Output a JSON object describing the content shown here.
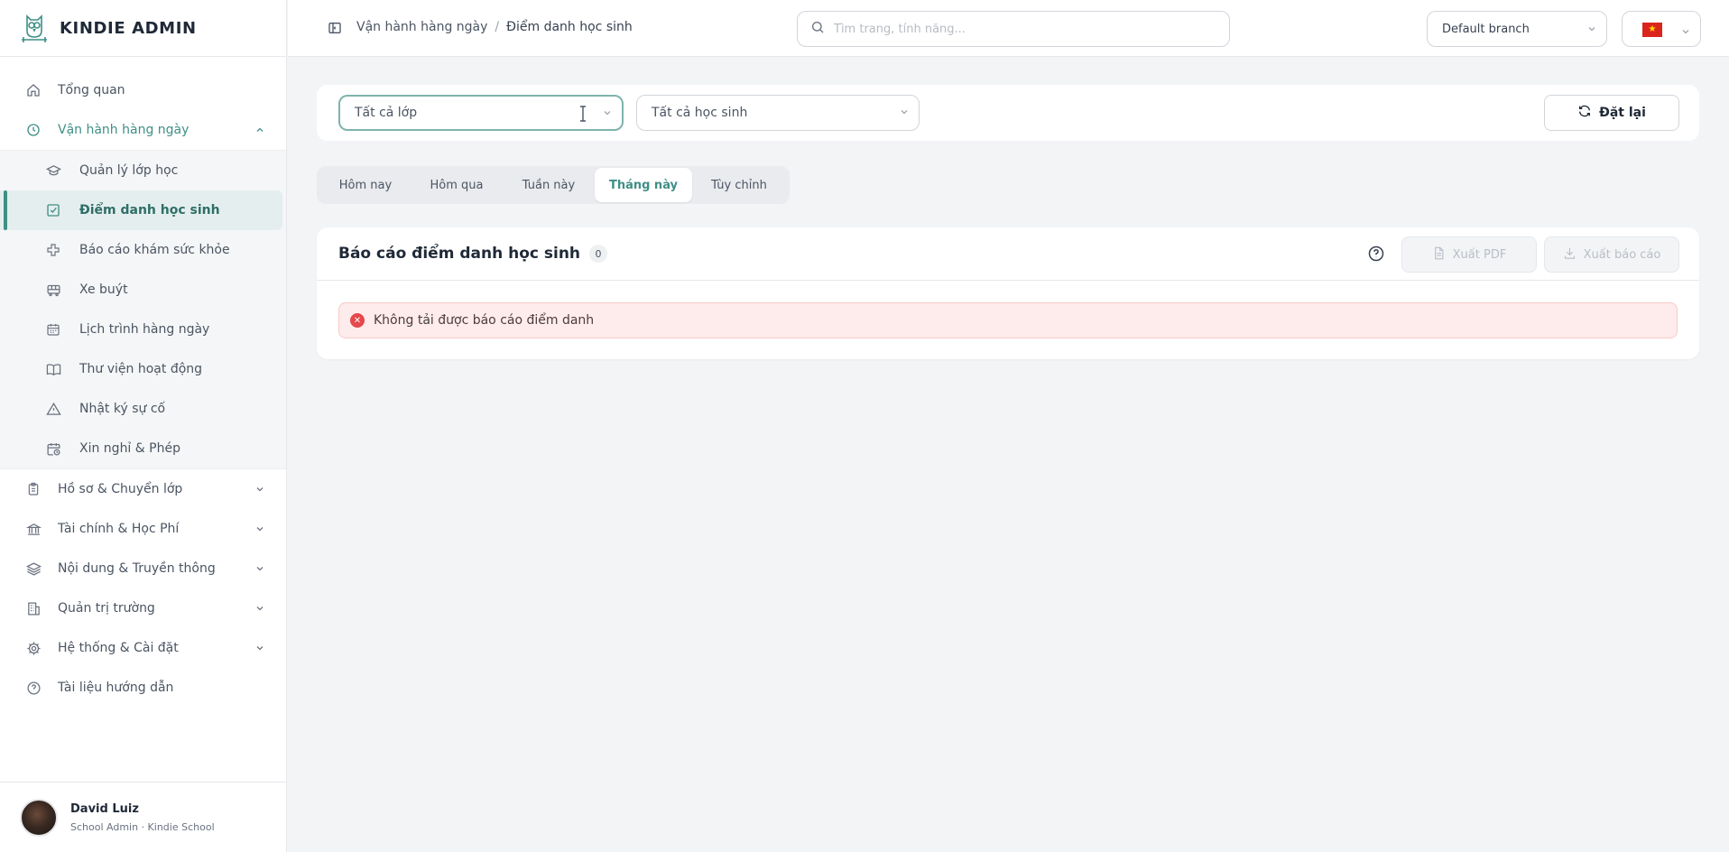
{
  "brand": {
    "name": "KINDIE ADMIN"
  },
  "topbar": {
    "breadcrumb": [
      "Vận hành hàng ngày",
      "Điểm danh học sinh"
    ],
    "breadcrumb_sep": "/",
    "search_placeholder": "Tìm trang, tính năng...",
    "branch": "Default branch",
    "language_flag": "vietnam-flag"
  },
  "sidebar": {
    "top_items": [
      {
        "label": "Tổng quan",
        "icon": "home-icon"
      },
      {
        "label": "Vận hành hàng ngày",
        "icon": "clock-icon",
        "expanded": true
      }
    ],
    "sub_items": [
      {
        "label": "Quản lý lớp học",
        "icon": "graduation-cap-icon"
      },
      {
        "label": "Điểm danh học sinh",
        "icon": "check-square-icon",
        "active": true
      },
      {
        "label": "Báo cáo khám sức khỏe",
        "icon": "medical-cross-icon"
      },
      {
        "label": "Xe buýt",
        "icon": "bus-icon"
      },
      {
        "label": "Lịch trình hàng ngày",
        "icon": "calendar-icon"
      },
      {
        "label": "Thư viện hoạt động",
        "icon": "book-icon"
      },
      {
        "label": "Nhật ký sự cố",
        "icon": "warning-icon"
      },
      {
        "label": "Xin nghỉ & Phép",
        "icon": "calendar-clock-icon"
      }
    ],
    "bottom_items": [
      {
        "label": "Hồ sơ & Chuyển lớp",
        "icon": "clipboard-icon"
      },
      {
        "label": "Tài chính & Học Phí",
        "icon": "bank-icon"
      },
      {
        "label": "Nội dung & Truyền thông",
        "icon": "layers-icon"
      },
      {
        "label": "Quản trị trường",
        "icon": "building-icon"
      },
      {
        "label": "Hệ thống & Cài đặt",
        "icon": "gear-icon"
      },
      {
        "label": "Tài liệu hướng dẫn",
        "icon": "help-circle-icon"
      }
    ]
  },
  "user": {
    "name": "David Luiz",
    "role": "School Admin · Kindie School"
  },
  "filters": {
    "class_select": "Tất cả lớp",
    "student_select": "Tất cả học sinh",
    "reset_label": "Đặt lại"
  },
  "tabs": [
    {
      "label": "Hôm nay"
    },
    {
      "label": "Hôm qua"
    },
    {
      "label": "Tuần này"
    },
    {
      "label": "Tháng này",
      "active": true
    },
    {
      "label": "Tùy chỉnh"
    }
  ],
  "report": {
    "title": "Báo cáo điểm danh học sinh",
    "count": "0",
    "export_pdf_label": "Xuất PDF",
    "export_report_label": "Xuất báo cáo",
    "error_message": "Không tải được báo cáo điểm danh"
  },
  "colors": {
    "accent": "#3f8f86",
    "active_bg": "#e5eeee",
    "error_bg": "#fdeceb",
    "error_icon": "#e5484d"
  }
}
